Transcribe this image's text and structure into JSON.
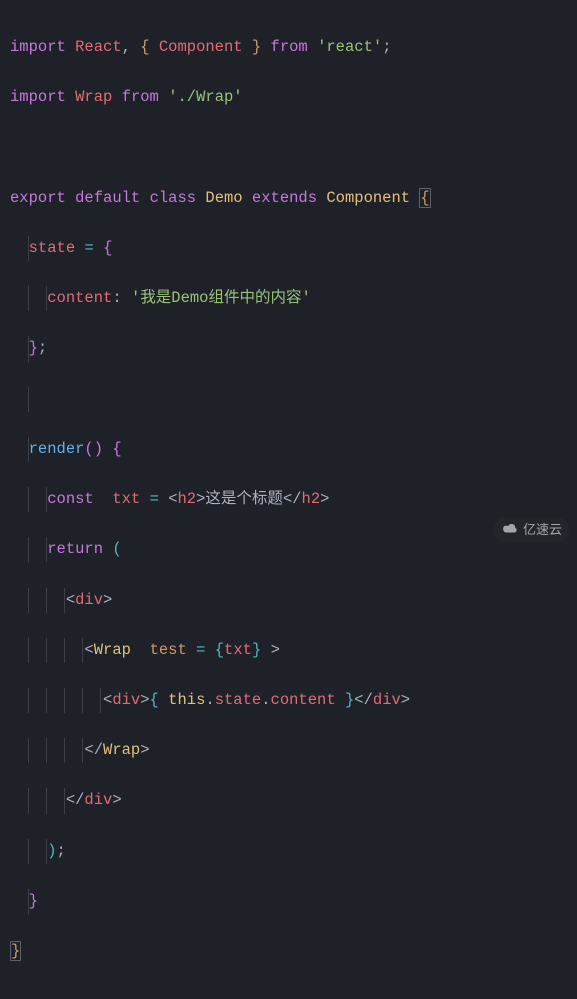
{
  "overlay": {
    "brand": "亿速云"
  },
  "code": {
    "lines": [
      {
        "kind": "import-react",
        "tokens": {
          "import": "import",
          "react": "React",
          "comma": ", ",
          "lbrace": "{",
          "component": "Component",
          "rbrace": "}",
          "from": "from",
          "mod": "'react'",
          "semi": ";"
        }
      },
      {
        "kind": "import-wrap",
        "tokens": {
          "import": "import",
          "wrap": "Wrap",
          "from": "from",
          "mod": "'./Wrap'"
        }
      },
      {
        "kind": "blank"
      },
      {
        "kind": "class",
        "tokens": {
          "export": "export",
          "default": "default",
          "class": "class",
          "demo": "Demo",
          "extends": "extends",
          "component": "Component",
          "lbrace": "{"
        }
      },
      {
        "kind": "state-open",
        "indent": 1,
        "tokens": {
          "state": "state",
          "eq": "=",
          "lbrace": "{"
        }
      },
      {
        "kind": "state-prop",
        "indent": 2,
        "tokens": {
          "key": "content",
          "colon": ":",
          "val": "'我是Demo组件中的内容'"
        }
      },
      {
        "kind": "state-close",
        "indent": 1,
        "tokens": {
          "rbrace": "}",
          "semi": ";"
        }
      },
      {
        "kind": "blank",
        "indent": 1
      },
      {
        "kind": "render",
        "indent": 1,
        "tokens": {
          "render": "render",
          "parens": "()",
          "lbrace": "{"
        }
      },
      {
        "kind": "const-txt",
        "indent": 2,
        "tokens": {
          "const": "const",
          "name": "txt",
          "eq": "=",
          "open": "<",
          "tag": "h2",
          "gt": ">",
          "text": "这是个标题",
          "close": "</",
          "tag2": "h2",
          "gt2": ">"
        }
      },
      {
        "kind": "return",
        "indent": 2,
        "tokens": {
          "return": "return",
          "lp": "("
        }
      },
      {
        "kind": "div-open",
        "indent": 3,
        "tokens": {
          "open": "<",
          "tag": "div",
          "gt": ">"
        }
      },
      {
        "kind": "wrap-open",
        "indent": 4,
        "tokens": {
          "open": "<",
          "tag": "Wrap",
          "attr": "test",
          "eq": "=",
          "lbrace": "{",
          "val": "txt",
          "rbrace": "}",
          "gt": ">"
        }
      },
      {
        "kind": "inner-div",
        "indent": 5,
        "tokens": {
          "open": "<",
          "tag": "div",
          "gt": ">",
          "jlb": "{",
          "this": "this",
          "dot1": ".",
          "state": "state",
          "dot2": ".",
          "content": "content",
          "jrb": "}",
          "close": "</",
          "tag2": "div",
          "gt2": ">"
        }
      },
      {
        "kind": "wrap-close",
        "indent": 4,
        "tokens": {
          "close": "</",
          "tag": "Wrap",
          "gt": ">"
        }
      },
      {
        "kind": "div-close",
        "indent": 3,
        "tokens": {
          "close": "</",
          "tag": "div",
          "gt": ">"
        }
      },
      {
        "kind": "return-close",
        "indent": 2,
        "tokens": {
          "rp": ")",
          "semi": ";"
        }
      },
      {
        "kind": "render-close",
        "indent": 1,
        "tokens": {
          "rbrace": "}"
        }
      },
      {
        "kind": "class-close",
        "tokens": {
          "rbrace": "}"
        }
      }
    ]
  }
}
